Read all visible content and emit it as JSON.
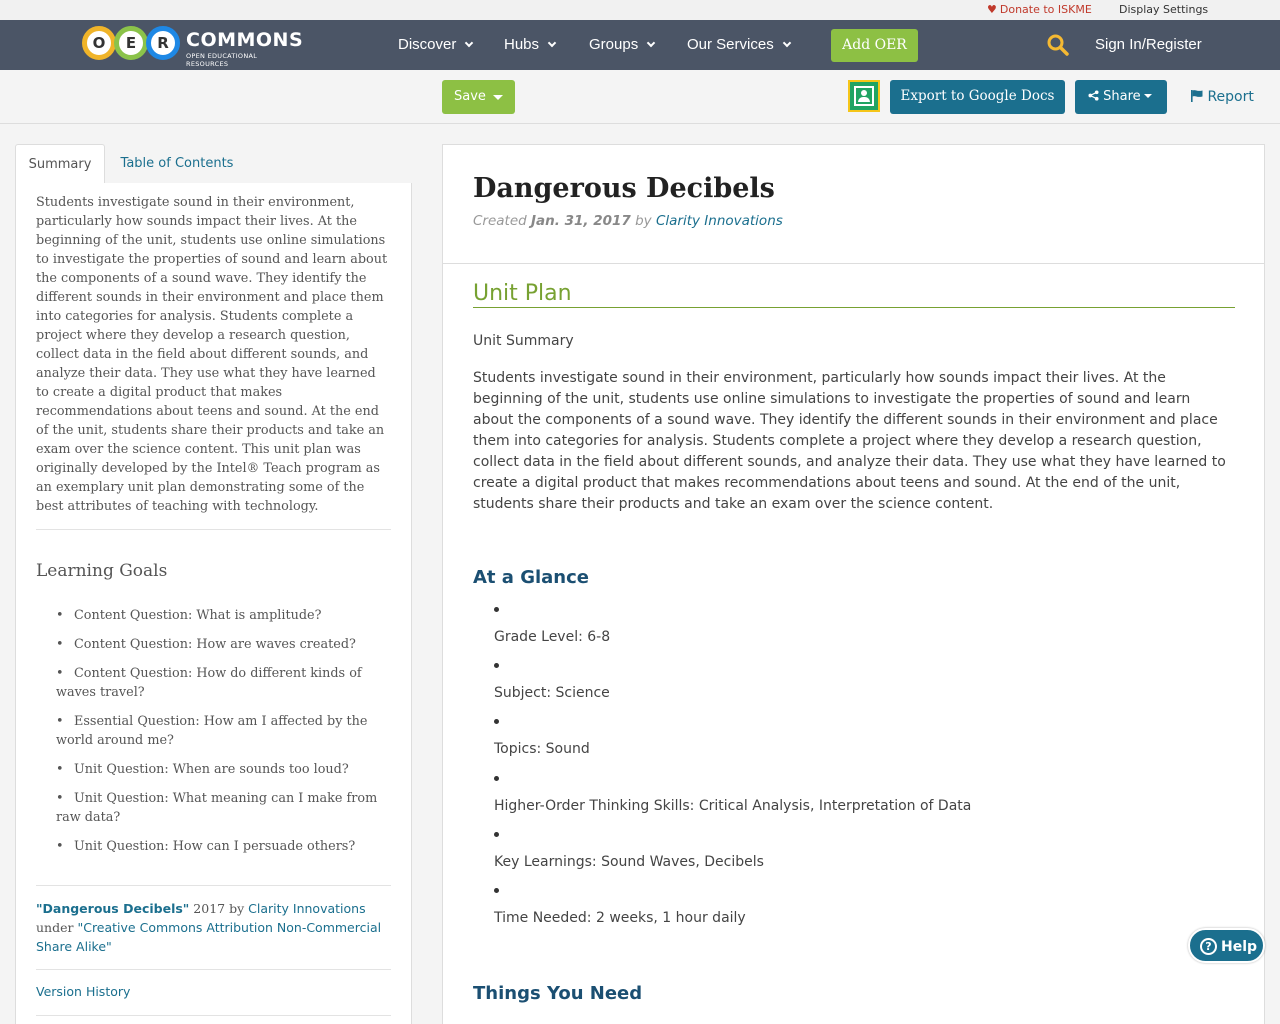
{
  "utility": {
    "donate_label": "Donate to ISKME",
    "display_settings_label": "Display Settings"
  },
  "logo": {
    "letters": [
      "O",
      "E",
      "R"
    ],
    "brand": "COMMONS",
    "tagline": "OPEN EDUCATIONAL RESOURCES"
  },
  "nav": {
    "items": [
      {
        "label": "Discover"
      },
      {
        "label": "Hubs"
      },
      {
        "label": "Groups"
      },
      {
        "label": "Our Services"
      }
    ],
    "add_oer_label": "Add OER",
    "signin_label": "Sign In/Register"
  },
  "toolbar": {
    "save_label": "Save",
    "export_label": "Export to Google Docs",
    "share_label": "Share",
    "report_label": "Report"
  },
  "sidebar": {
    "tabs": [
      {
        "label": "Summary"
      },
      {
        "label": "Table of Contents"
      }
    ],
    "summary": "Students investigate sound in their environment, particularly how sounds impact their lives. At the beginning of the unit, students use online simulations to investigate the properties of sound and learn about the components of a sound wave. They identify the different sounds in their environment and place them into categories for analysis. Students complete a project where they develop a research question, collect data in the field about different sounds, and analyze their data. They use what they have learned to create a digital product that makes recommendations about teens and sound. At the end of the unit, students share their products and take an exam over the science content. This unit plan was originally developed by the Intel® Teach program as an exemplary unit plan demonstrating some of the best attributes of teaching with technology.",
    "learning_goals_heading": "Learning Goals",
    "goals": [
      "Content Question: What is amplitude?",
      "Content Question: How are waves created?",
      "Content Question: How do different kinds of waves travel?",
      "Essential Question: How am I affected by the world around me?",
      "Unit Question: When are sounds too loud?",
      "Unit Question: What meaning can I make from raw data?",
      "Unit Question: How can I persuade others?"
    ],
    "attribution": {
      "title": "\"Dangerous Decibels\"",
      "year": "2017",
      "by": "by",
      "author": "Clarity Innovations",
      "under": "under",
      "license": "\"Creative Commons Attribution Non-Commercial Share Alike\""
    },
    "version_history_label": "Version History"
  },
  "main": {
    "title": "Dangerous Decibels",
    "created_label": "Created",
    "created_date": "Jan. 31, 2017",
    "by_label": "by",
    "author": "Clarity Innovations",
    "section_heading": "Unit Plan",
    "unit_summary_label": "Unit Summary",
    "unit_summary_text": "Students investigate sound in their environment, particularly how sounds impact their lives. At the beginning of the unit, students use online simulations to investigate the properties of sound and learn about the components of a sound wave. They identify the different sounds in their environment and place them into categories for analysis. Students complete a project where they develop a research question, collect data in the field about different sounds, and analyze their data. They use what they have learned to create a digital product that makes recommendations about teens and sound. At the end of the unit, students share their products and take an exam over the science content.",
    "at_a_glance_heading": "At a Glance",
    "glance": [
      "Grade Level: 6-8",
      "Subject: Science",
      "Topics: Sound",
      "Higher-Order Thinking Skills: Critical Analysis, Interpretation of Data",
      "Key Learnings: Sound Waves, Decibels",
      "Time Needed: 2 weeks, 1 hour daily"
    ],
    "things_you_need_heading": "Things You Need"
  },
  "help_label": "Help",
  "colors": {
    "navbar": "#4b5566",
    "accent_green": "#8dc044",
    "accent_teal": "#1b6f8e",
    "heading_navy": "#1b4f72",
    "donate_red": "#c0392b"
  },
  "icons": [
    "heart-icon",
    "search-icon",
    "chevron-down-icon",
    "google-classroom-icon",
    "share-icon",
    "flag-icon",
    "help-icon"
  ]
}
